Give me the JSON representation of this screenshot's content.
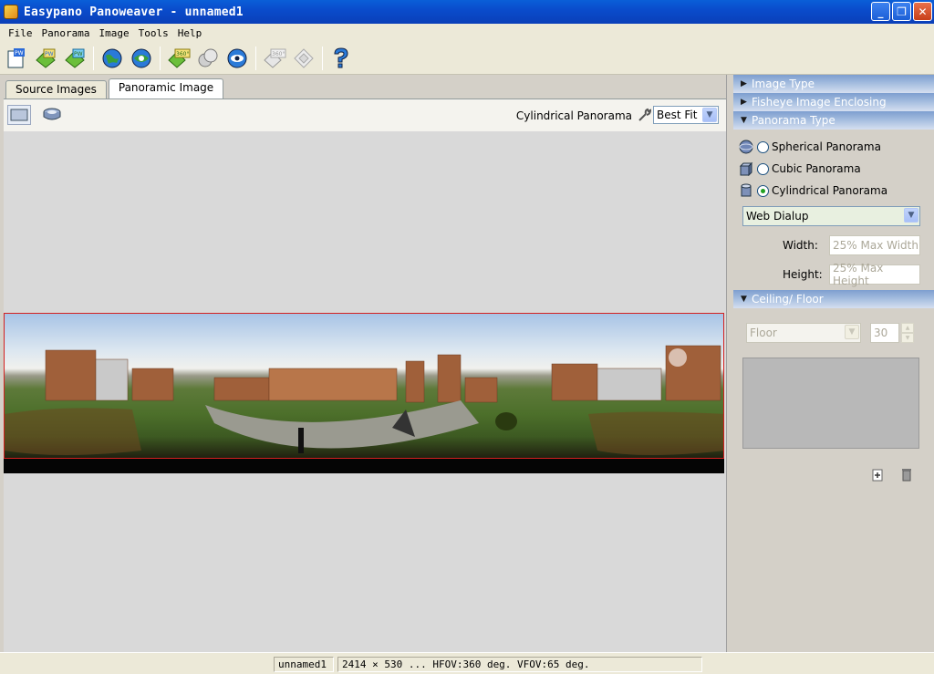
{
  "window": {
    "title": "Easypano Panoweaver - unnamed1",
    "minimize_glyph": "_",
    "restore_glyph": "❐",
    "close_glyph": "✕"
  },
  "menu": [
    "File",
    "Panorama",
    "Image",
    "Tools",
    "Help"
  ],
  "toolbar": {
    "icons": [
      "new-project-icon",
      "open-pw-icon",
      "save-pw-icon",
      "globe-icon",
      "globe-stitch-icon",
      "publish-360-icon",
      "blend-icon",
      "preview-eye-icon",
      "export-360-icon",
      "export-alt-icon",
      "help-icon"
    ],
    "badge_pw": "PW",
    "badge_360": "360°"
  },
  "tabs": [
    {
      "label": "Source Images",
      "active": false
    },
    {
      "label": "Panoramic Image",
      "active": true
    }
  ],
  "viewer": {
    "panorama_type_label": "Cylindrical Panorama",
    "fit_value": "Best Fit"
  },
  "right_panel": {
    "sections": {
      "image_type": "Image Type",
      "fisheye": "Fisheye Image Enclosing",
      "panorama_type": "Panorama Type",
      "ceiling_floor": "Ceiling/ Floor"
    },
    "panorama_options": [
      {
        "label": "Spherical Panorama",
        "checked": false
      },
      {
        "label": "Cubic Panorama",
        "checked": false
      },
      {
        "label": "Cylindrical Panorama",
        "checked": true
      }
    ],
    "quality": "Web Dialup",
    "width_label": "Width:",
    "width_value": "25% Max Width",
    "height_label": "Height:",
    "height_value": "25% Max Height",
    "floor_select": "Floor",
    "floor_spinner": "30"
  },
  "status": {
    "project": "unnamed1",
    "info": "2414 × 530 ... HFOV:360 deg. VFOV:65 deg."
  },
  "colors": {
    "title_blue": "#0a4ccc",
    "panel_header": "#7d9ecf",
    "selection_red": "#d32020"
  }
}
